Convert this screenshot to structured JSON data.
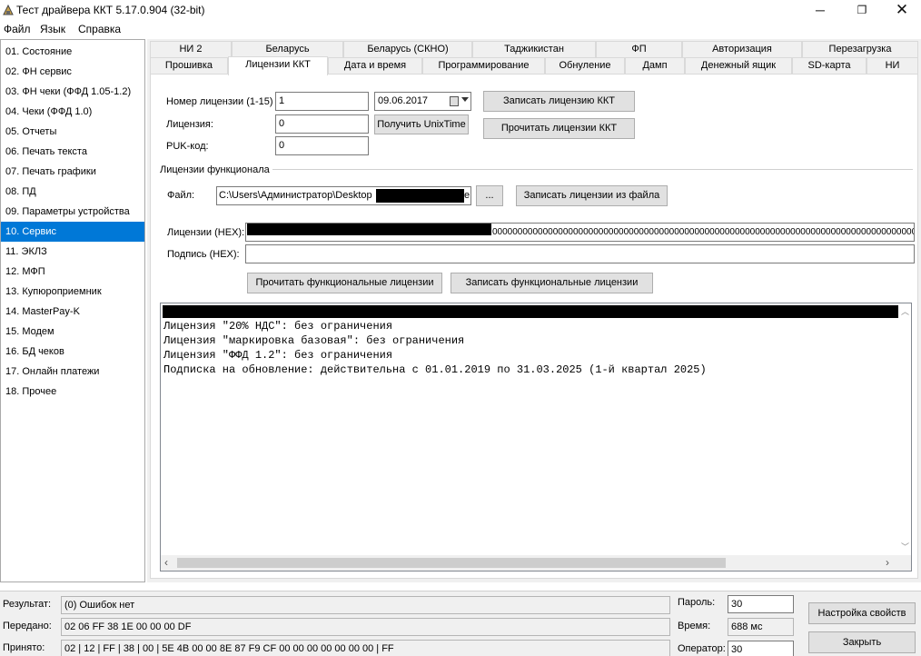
{
  "window": {
    "title": "Тест драйвера ККТ 5.17.0.904 (32-bit)",
    "minimize": "─",
    "maximize": "❐",
    "close": "✕"
  },
  "menu": [
    "Файл",
    "Язык",
    "Справка"
  ],
  "sidebar": {
    "items": [
      "01. Состояние",
      "02. ФН сервис",
      "03. ФН чеки (ФФД 1.05-1.2)",
      "04. Чеки (ФФД 1.0)",
      "05. Отчеты",
      "06. Печать текста",
      "07. Печать графики",
      "08. ПД",
      "09. Параметры устройства",
      "10. Сервис",
      "11. ЭКЛЗ",
      "12. МФП",
      "13. Купюроприемник",
      "14. MasterPay-K",
      "15. Модем",
      "16. БД чеков",
      "17. Онлайн платежи",
      "18. Прочее"
    ],
    "selected_index": 9
  },
  "tabs": {
    "row1": [
      "НИ 2",
      "Беларусь",
      "Беларусь (СКНО)",
      "Таджикистан",
      "ФП",
      "Авторизация",
      "Перезагрузка"
    ],
    "row2": [
      "Прошивка",
      "Лицензии ККТ",
      "Дата и время",
      "Программирование",
      "Обнуление",
      "Дамп",
      "Денежный ящик",
      "SD-карта",
      "НИ"
    ],
    "active": "Лицензии ККТ"
  },
  "license": {
    "number_label": "Номер лицензии (1-15)",
    "number_value": "1",
    "date_value": "09.06.2017",
    "license_label": "Лицензия:",
    "license_value": "0",
    "puk_label": "PUK-код:",
    "puk_value": "0",
    "unixtime_button": "Получить UnixTime",
    "write_button": "Записать лицензию ККТ",
    "read_button": "Прочитать лицензии ККТ"
  },
  "functional": {
    "group_title": "Лицензии функционала",
    "file_label": "Файл:",
    "file_value": "C:\\Users\\Администратор\\Desktop",
    "file_suffix": "e:",
    "browse_button": "...",
    "write_from_file_button": "Записать лицензии из файла",
    "hex_label": "Лицензии (HEX):",
    "hex_value": "000000000000000000000000000000000000000000000000000000000000000000000000000000000000000000000000000000",
    "signature_label": "Подпись (HEX):",
    "signature_value": "",
    "read_func_button": "Прочитать функциональные лицензии",
    "write_func_button": "Записать функциональные лицензии"
  },
  "output": {
    "lines": [
      "Лицензия \"20% НДС\": без ограничения",
      "Лицензия \"маркировка базовая\": без ограничения",
      "Лицензия \"ФФД 1.2\": без ограничения",
      "Подписка на обновление: действительна с 01.01.2019 по 31.03.2025 (1-й квартал 2025)"
    ]
  },
  "status": {
    "result_label": "Результат:",
    "result_value": "(0) Ошибок нет",
    "sent_label": "Передано:",
    "sent_value": "02 06 FF 38 1E 00 00 00 DF",
    "received_label": "Принято:",
    "received_value": "02 | 12 | FF | 38 | 00 | 5E 4B 00 00 8E 87 F9 CF 00 00 00 00 00 00 00 | FF",
    "password_label": "Пароль:",
    "password_value": "30",
    "time_label": "Время:",
    "time_value": "688 мс",
    "operator_label": "Оператор:",
    "operator_value": "30",
    "settings_button": "Настройка свойств",
    "close_button": "Закрыть"
  }
}
